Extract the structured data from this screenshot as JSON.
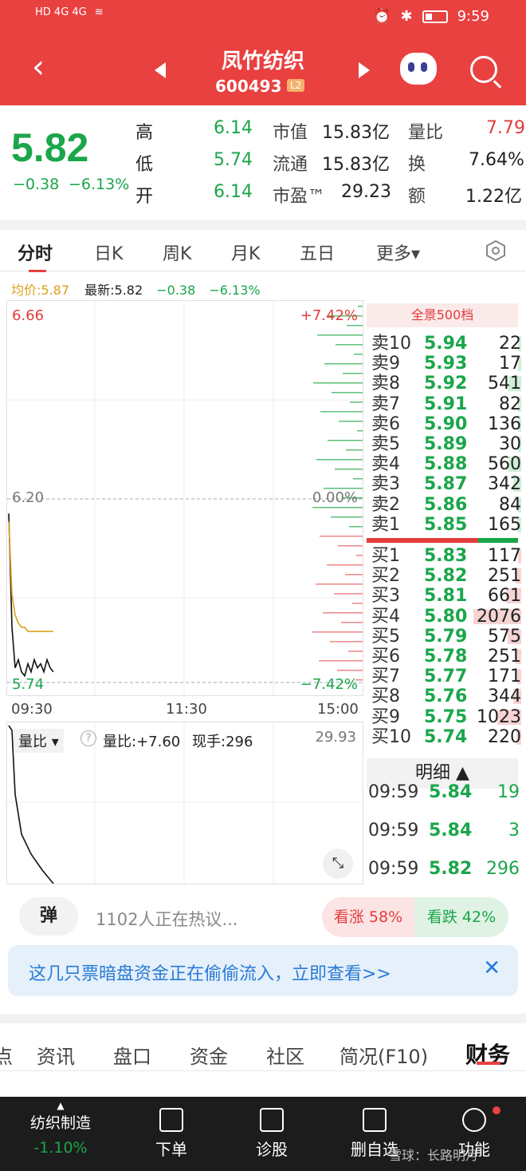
{
  "status_bar": {
    "network": "HD 4G 4G",
    "time": "9:59"
  },
  "header": {
    "name": "凤竹纺织",
    "code": "600493",
    "level_badge": "L2",
    "back_icon": "chevron-left-icon",
    "robot_icon": "robot-icon",
    "search_icon": "search-icon"
  },
  "quote": {
    "price": "5.82",
    "change": "−0.38",
    "change_pct": "−6.13%",
    "rows": [
      {
        "l1": "高",
        "v1": "6.14",
        "l2": "市值",
        "v2": "15.83亿",
        "l3": "量比",
        "v3": "7.79"
      },
      {
        "l1": "低",
        "v1": "5.74",
        "l2": "流通",
        "v2": "15.83亿",
        "l3": "换",
        "v3": "7.64%"
      },
      {
        "l1": "开",
        "v1": "6.14",
        "l2": "市盈™",
        "v2": "29.23",
        "l3": "额",
        "v3": "1.22亿"
      }
    ]
  },
  "tabs": [
    "分时",
    "日K",
    "周K",
    "月K",
    "五日",
    "更多▾"
  ],
  "avg_bar": {
    "avg": "均价:5.87",
    "latest": "最新:5.82",
    "chg": "−0.38",
    "pct": "−6.13%"
  },
  "chart": {
    "high_label": "6.66",
    "mid_label": "6.20",
    "low_label": "5.74",
    "pct_high": "+7.42%",
    "pct_mid": "0.00%",
    "pct_low": "−7.42%",
    "times": [
      "09:30",
      "11:30",
      "15:00"
    ]
  },
  "volume": {
    "selector": "量比 ▾",
    "ratio": "量比:+7.60",
    "now": "现手:296",
    "max": "29.93"
  },
  "chart_data": {
    "type": "line",
    "ylim": [
      5.74,
      6.66
    ],
    "ref": 6.2,
    "x": [
      0,
      1,
      2,
      3,
      4,
      5,
      6,
      7,
      8,
      9,
      10,
      11,
      12,
      13,
      14
    ],
    "series": [
      {
        "values": [
          6.16,
          5.88,
          5.78,
          5.8,
          5.77,
          5.76,
          5.79,
          5.77,
          5.8,
          5.78,
          5.79,
          5.77,
          5.8,
          5.78,
          5.77
        ]
      },
      {
        "values": [
          6.14,
          5.96,
          5.91,
          5.89,
          5.88,
          5.88,
          5.87,
          5.87,
          5.87,
          5.87,
          5.87,
          5.87,
          5.87,
          5.87,
          5.87
        ]
      }
    ]
  },
  "order_book": {
    "title": "全景500档",
    "asks": [
      {
        "label": "卖10",
        "price": "5.94",
        "vol": "22"
      },
      {
        "label": "卖9",
        "price": "5.93",
        "vol": "17"
      },
      {
        "label": "卖8",
        "price": "5.92",
        "vol": "541"
      },
      {
        "label": "卖7",
        "price": "5.91",
        "vol": "82"
      },
      {
        "label": "卖6",
        "price": "5.90",
        "vol": "136"
      },
      {
        "label": "卖5",
        "price": "5.89",
        "vol": "30"
      },
      {
        "label": "卖4",
        "price": "5.88",
        "vol": "560"
      },
      {
        "label": "卖3",
        "price": "5.87",
        "vol": "342"
      },
      {
        "label": "卖2",
        "price": "5.86",
        "vol": "84"
      },
      {
        "label": "卖1",
        "price": "5.85",
        "vol": "165"
      }
    ],
    "bids": [
      {
        "label": "买1",
        "price": "5.83",
        "vol": "117"
      },
      {
        "label": "买2",
        "price": "5.82",
        "vol": "251"
      },
      {
        "label": "买3",
        "price": "5.81",
        "vol": "661"
      },
      {
        "label": "买4",
        "price": "5.80",
        "vol": "2076"
      },
      {
        "label": "买5",
        "price": "5.79",
        "vol": "575"
      },
      {
        "label": "买6",
        "price": "5.78",
        "vol": "251"
      },
      {
        "label": "买7",
        "price": "5.77",
        "vol": "171"
      },
      {
        "label": "买8",
        "price": "5.76",
        "vol": "344"
      },
      {
        "label": "买9",
        "price": "5.75",
        "vol": "1023"
      },
      {
        "label": "买10",
        "price": "5.74",
        "vol": "220"
      }
    ]
  },
  "detail": {
    "button": "明细 ▲",
    "trades": [
      {
        "time": "09:59",
        "price": "5.84",
        "vol": "19"
      },
      {
        "time": "09:59",
        "price": "5.84",
        "vol": "3"
      },
      {
        "time": "09:59",
        "price": "5.82",
        "vol": "296"
      }
    ]
  },
  "social": {
    "danmu": "弹",
    "discuss": "1102人正在热议...",
    "bull": "看涨 58%",
    "bear": "看跌 42%"
  },
  "banner": {
    "text": "这几只票暗盘资金正在偷偷流入，立即查看>>",
    "close": "✕"
  },
  "news_tabs": [
    "点",
    "资讯",
    "盘口",
    "资金",
    "社区",
    "简况(F10)",
    "财务"
  ],
  "toolbar": [
    {
      "label": "纺织制造",
      "sub": "-1.10%"
    },
    {
      "label": "下单"
    },
    {
      "label": "诊股"
    },
    {
      "label": "删自选"
    },
    {
      "label": "功能"
    }
  ],
  "watermark": "雪球：长路明月"
}
